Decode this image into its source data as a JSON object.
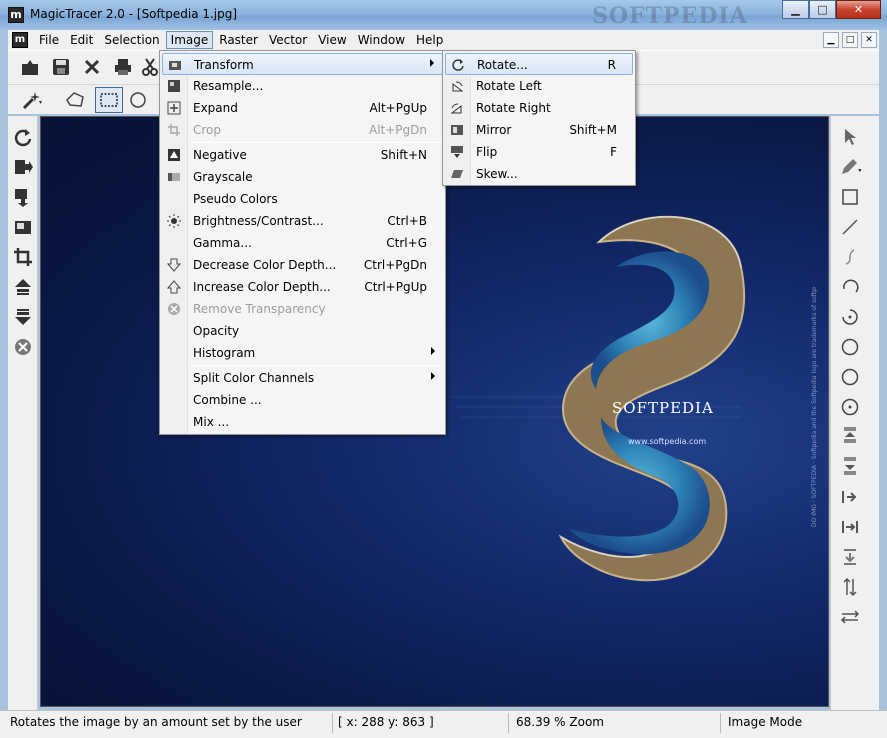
{
  "window": {
    "title": "MagicTracer 2.0 - [Softpedia 1.jpg]",
    "app_icon_letter": "m",
    "watermark": "SOFTPEDIA",
    "minimize": "▁",
    "maximize": "□",
    "close": "✕"
  },
  "menubar": {
    "items": [
      "File",
      "Edit",
      "Selection",
      "Image",
      "Raster",
      "Vector",
      "View",
      "Window",
      "Help"
    ],
    "active": "Image"
  },
  "image_menu": [
    {
      "label": "Transform",
      "shortcut": "",
      "submenu": true,
      "highlighted": true
    },
    {
      "label": "Resample...",
      "shortcut": ""
    },
    {
      "label": "Expand",
      "shortcut": "Alt+PgUp"
    },
    {
      "label": "Crop",
      "shortcut": "Alt+PgDn",
      "disabled": true
    },
    {
      "label": "Negative",
      "shortcut": "Shift+N"
    },
    {
      "label": "Grayscale",
      "shortcut": ""
    },
    {
      "label": "Pseudo Colors",
      "shortcut": ""
    },
    {
      "label": "Brightness/Contrast...",
      "shortcut": "Ctrl+B"
    },
    {
      "label": "Gamma...",
      "shortcut": "Ctrl+G"
    },
    {
      "label": "Decrease Color Depth...",
      "shortcut": "Ctrl+PgDn"
    },
    {
      "label": "Increase Color Depth...",
      "shortcut": "Ctrl+PgUp"
    },
    {
      "label": "Remove Transparency",
      "shortcut": "",
      "disabled": true
    },
    {
      "label": "Opacity",
      "shortcut": ""
    },
    {
      "label": "Histogram",
      "shortcut": "",
      "submenu": true
    },
    {
      "label": "Split Color Channels",
      "shortcut": "",
      "submenu": true
    },
    {
      "label": "Combine ...",
      "shortcut": ""
    },
    {
      "label": "Mix ...",
      "shortcut": ""
    }
  ],
  "transform_menu": [
    {
      "label": "Rotate...",
      "shortcut": "R",
      "highlighted": true
    },
    {
      "label": "Rotate Left",
      "shortcut": ""
    },
    {
      "label": "Rotate Right",
      "shortcut": ""
    },
    {
      "label": "Mirror",
      "shortcut": "Shift+M"
    },
    {
      "label": "Flip",
      "shortcut": "F"
    },
    {
      "label": "Skew...",
      "shortcut": ""
    }
  ],
  "canvas": {
    "brand": "SOFTPEDIA",
    "url": "www.softpedia.com",
    "vertical_text": "DO IMG · SOFTPEDIA · Softpedia and the Softpedia logo are trademarks of softpedia.com"
  },
  "statusbar": {
    "hint": "Rotates the image by an amount set by the user",
    "coords": "[ x: 288 y: 863 ]",
    "zoom": "68.39 % Zoom",
    "mode": "Image Mode"
  }
}
